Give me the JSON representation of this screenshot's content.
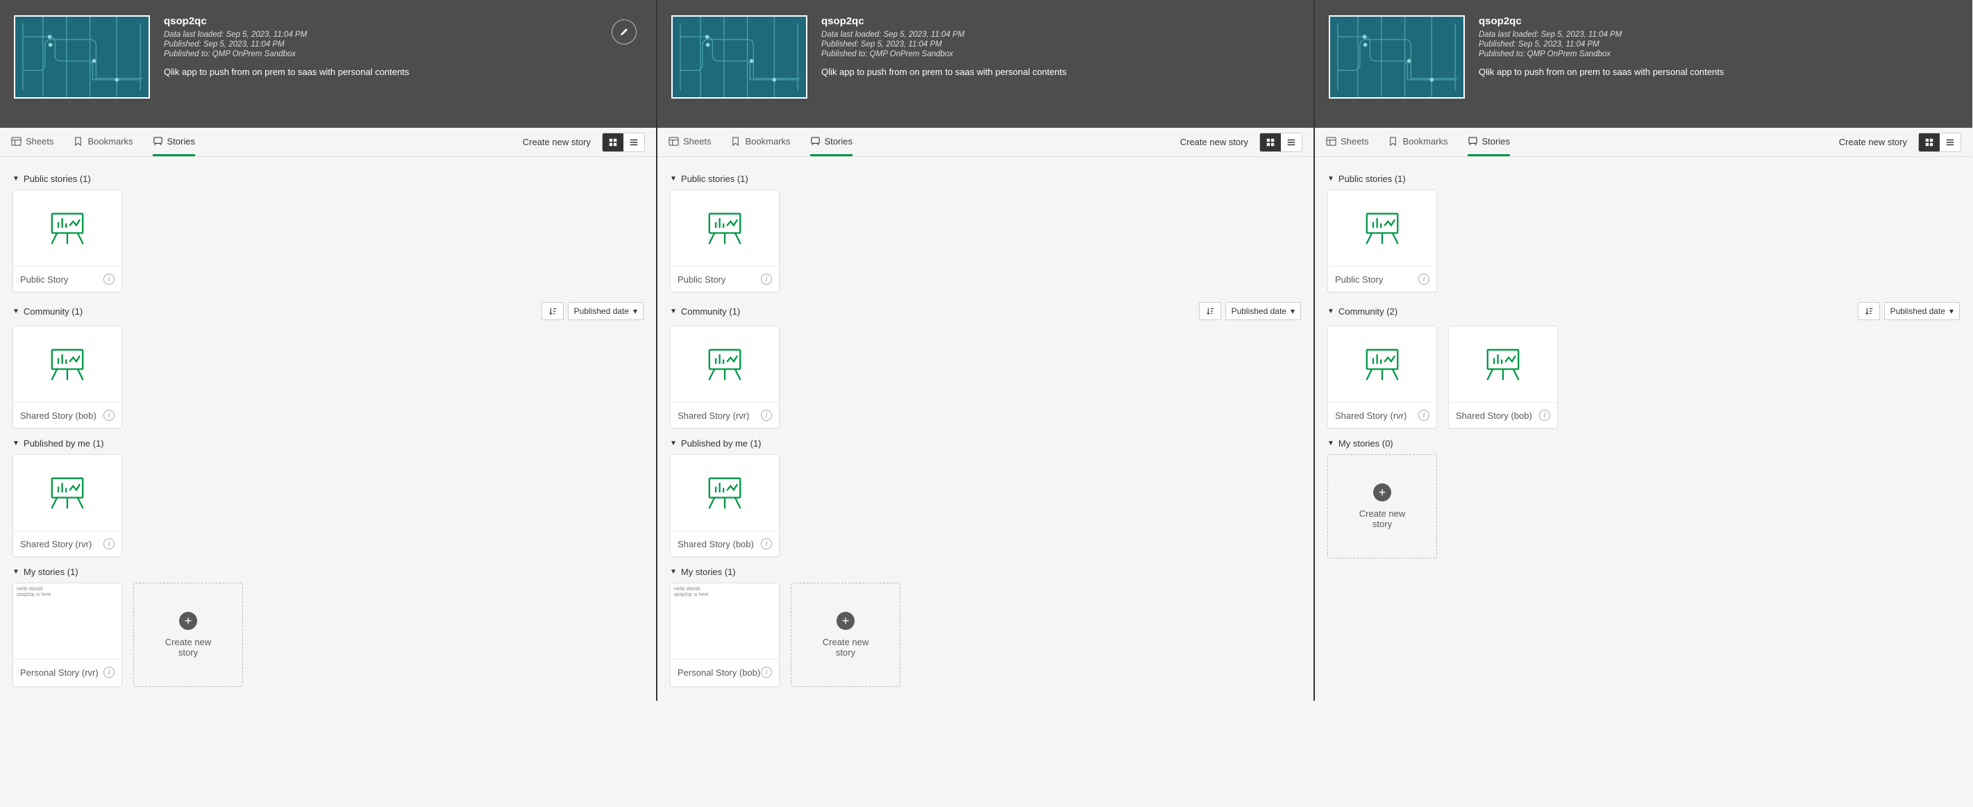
{
  "app": {
    "title": "qsop2qc",
    "loaded": "Data last loaded: Sep 5, 2023, 11:04 PM",
    "published": "Published: Sep 5, 2023, 11:04 PM",
    "publishedTo": "Published to: QMP OnPrem Sandbox",
    "desc": "Qlik app to push from on prem to saas with personal contents"
  },
  "tabs": {
    "sheets": "Sheets",
    "bookmarks": "Bookmarks",
    "stories": "Stories"
  },
  "actions": {
    "createStory": "Create new story",
    "sortLabel": "Published date",
    "createCard": "Create new story"
  },
  "panels": [
    {
      "editable": true,
      "sections": [
        {
          "id": "public",
          "title": "Public stories (1)",
          "sortable": false,
          "cards": [
            {
              "label": "Public Story",
              "preview": "easel"
            }
          ]
        },
        {
          "id": "community",
          "title": "Community (1)",
          "sortable": true,
          "cards": [
            {
              "label": "Shared Story (bob)",
              "preview": "easel"
            }
          ]
        },
        {
          "id": "byme",
          "title": "Published by me (1)",
          "sortable": false,
          "cards": [
            {
              "label": "Shared Story (rvr)",
              "preview": "easel"
            }
          ]
        },
        {
          "id": "mine",
          "title": "My stories (1)",
          "sortable": false,
          "cards": [
            {
              "label": "Personal Story (rvr)",
              "preview": "text"
            }
          ],
          "create": true
        }
      ]
    },
    {
      "editable": false,
      "sections": [
        {
          "id": "public",
          "title": "Public stories (1)",
          "sortable": false,
          "cards": [
            {
              "label": "Public Story",
              "preview": "easel"
            }
          ]
        },
        {
          "id": "community",
          "title": "Community (1)",
          "sortable": true,
          "cards": [
            {
              "label": "Shared Story (rvr)",
              "preview": "easel"
            }
          ]
        },
        {
          "id": "byme",
          "title": "Published by me (1)",
          "sortable": false,
          "cards": [
            {
              "label": "Shared Story (bob)",
              "preview": "easel"
            }
          ]
        },
        {
          "id": "mine",
          "title": "My stories (1)",
          "sortable": false,
          "cards": [
            {
              "label": "Personal Story (bob)",
              "preview": "text"
            }
          ],
          "create": true
        }
      ]
    },
    {
      "editable": false,
      "sections": [
        {
          "id": "public",
          "title": "Public stories (1)",
          "sortable": false,
          "cards": [
            {
              "label": "Public Story",
              "preview": "easel"
            }
          ]
        },
        {
          "id": "community",
          "title": "Community (2)",
          "sortable": true,
          "cards": [
            {
              "label": "Shared Story (rvr)",
              "preview": "easel"
            },
            {
              "label": "Shared Story (bob)",
              "preview": "easel"
            }
          ]
        },
        {
          "id": "mine",
          "title": "My stories (0)",
          "sortable": false,
          "cards": [],
          "create": true
        }
      ]
    }
  ],
  "previewText": "Hello World!\nqsop2qc is here"
}
